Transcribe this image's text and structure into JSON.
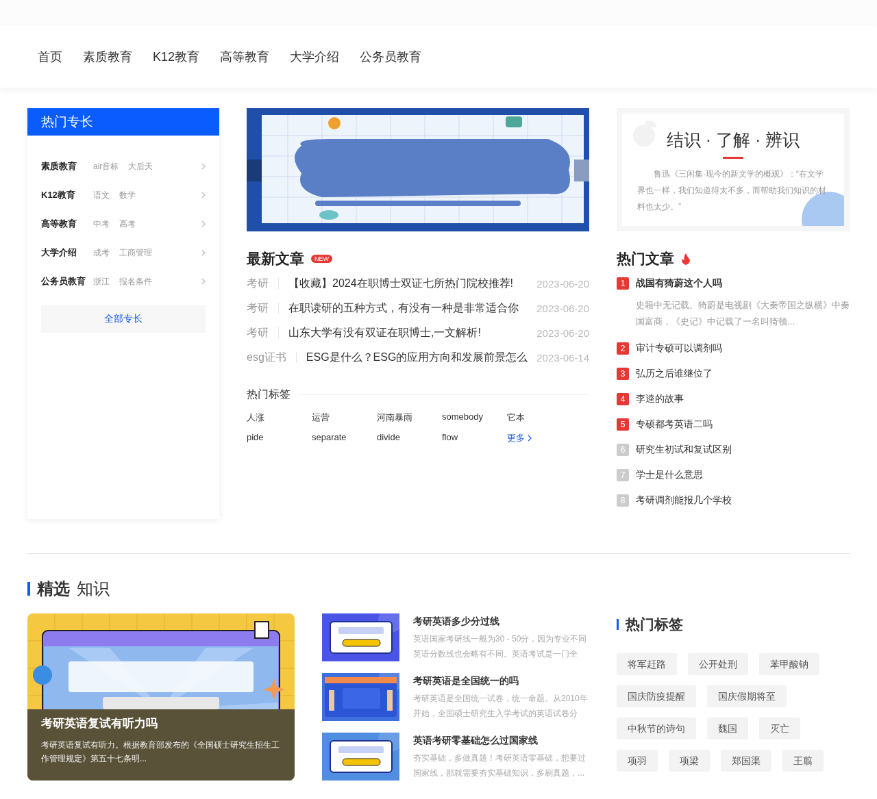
{
  "nav": {
    "items": [
      {
        "label": "首页"
      },
      {
        "label": "素质教育"
      },
      {
        "label": "K12教育"
      },
      {
        "label": "高等教育"
      },
      {
        "label": "大学介绍"
      },
      {
        "label": "公务员教育"
      }
    ]
  },
  "specialties": {
    "title": "热门专长",
    "items": [
      {
        "name": "素质教育",
        "tags": [
          "air音标",
          "大后天"
        ]
      },
      {
        "name": "K12教育",
        "tags": [
          "语文",
          "数学"
        ]
      },
      {
        "name": "高等教育",
        "tags": [
          "中考",
          "高考"
        ]
      },
      {
        "name": "大学介绍",
        "tags": [
          "成考",
          "工商管理"
        ]
      },
      {
        "name": "公务员教育",
        "tags": [
          "浙江",
          "报名条件"
        ]
      }
    ],
    "all_button": "全部专长"
  },
  "latest": {
    "title": "最新文章",
    "badge": "NEW",
    "articles": [
      {
        "category": "考研",
        "title": "【收藏】2024在职博士双证七所热门院校推荐!",
        "date": "2023-06-20"
      },
      {
        "category": "考研",
        "title": "在职读研的五种方式，有没有一种是非常适合你",
        "date": "2023-06-20"
      },
      {
        "category": "考研",
        "title": "山东大学有没有双证在职博士,一文解析!",
        "date": "2023-06-20"
      },
      {
        "category": "esg证书",
        "title": "ESG是什么？ESG的应用方向和发展前景怎么",
        "date": "2023-06-14"
      }
    ]
  },
  "tags_panel": {
    "title": "热门标签",
    "tags": [
      "人涨",
      "运营",
      "河南暴雨",
      "somebody",
      "它本",
      "pide",
      "separate",
      "divide",
      "flow"
    ],
    "more": "更多"
  },
  "quote": {
    "title": "结识 · 了解 · 辨识",
    "text": "鲁迅《三闲集·现今的新文学的概观》：“在文学界也一样，我们知道得太不多，而帮助我们知识的材料也太少。”"
  },
  "hot": {
    "title": "热门文章",
    "items": [
      {
        "rank": "1",
        "title": "战国有猗蔚这个人吗",
        "hot": true,
        "expanded": true,
        "summary": "史籍中无记载。猗蔚是电视剧《大秦帝国之纵横》中秦国富商，《史记》中记载了一名叫猗顿..."
      },
      {
        "rank": "2",
        "title": "审计专硕可以调剂吗",
        "hot": true,
        "expanded": false
      },
      {
        "rank": "3",
        "title": "弘历之后谁继位了",
        "hot": true,
        "expanded": false
      },
      {
        "rank": "4",
        "title": "李逵的故事",
        "hot": true,
        "expanded": false
      },
      {
        "rank": "5",
        "title": "专硕都考英语二吗",
        "hot": true,
        "expanded": false
      },
      {
        "rank": "6",
        "title": "研究生初试和复试区别",
        "hot": false,
        "expanded": false
      },
      {
        "rank": "7",
        "title": "学士是什么意思",
        "hot": false,
        "expanded": false
      },
      {
        "rank": "8",
        "title": "考研调剂能报几个学校",
        "hot": false,
        "expanded": false
      }
    ]
  },
  "featured": {
    "title_bold": "精选",
    "title_rest": "知识",
    "main": {
      "kind": "picture",
      "title": "考研英语复试有听力吗",
      "summary": "考研英语复试有听力。根据教育部发布的《全国硕士研究生招生工作管理规定》第五十七条明..."
    },
    "list": [
      {
        "title": "考研英语多少分过线",
        "summary": "英语国家考研线一般为30 - 50分，因为专业不同英语分数线也会略有不同。英语考试是一门全"
      },
      {
        "title": "考研英语是全国统一的吗",
        "summary": "考研英语是全国统一试卷，统一命题。从2010年开始，全国硕士研究生入学考试的英语试卷分"
      },
      {
        "title": "英语考研零基础怎么过国家线",
        "summary": "夯实基础，多做真题！考研英语零基础，想要过国家线，那就需要夯实基础知识，多刷真题，..."
      }
    ]
  },
  "hot_tags": {
    "title": "热门标签",
    "tags": [
      "将军赶路",
      "公开处刑",
      "苯甲酸钠",
      "国庆防疫提醒",
      "国庆假期将至",
      "中秋节的诗句",
      "魏国",
      "灭亡",
      "项羽",
      "项梁",
      "郑国渠",
      "王翦"
    ]
  }
}
